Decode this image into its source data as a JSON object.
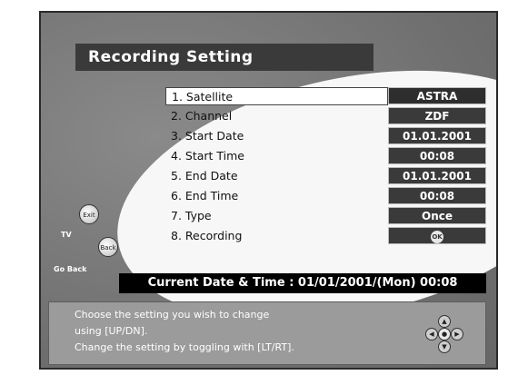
{
  "title": "Recording Setting",
  "rows": [
    {
      "label": "1. Satellite",
      "value": "ASTRA"
    },
    {
      "label": "2. Channel",
      "value": "ZDF"
    },
    {
      "label": "3. Start Date",
      "value": "01.01.2001"
    },
    {
      "label": "4. Start Time",
      "value": "00:08"
    },
    {
      "label": "5. End Date",
      "value": "01.01.2001"
    },
    {
      "label": "6. End Time",
      "value": "00:08"
    },
    {
      "label": "7. Type",
      "value": "Once"
    },
    {
      "label": "8. Recording",
      "value": ""
    }
  ],
  "side_buttons": {
    "exit": "Exit",
    "tv": "TV",
    "back": "Back",
    "go_back": "Go Back"
  },
  "current_datetime": "Current Date & Time : 01/01/2001/(Mon)   00:08",
  "help": {
    "line1": "Choose the setting you wish to change",
    "line2": "using [UP/DN].",
    "line3": "Change the setting by toggling with [LT/RT]."
  },
  "icons": {
    "ok": "OK"
  }
}
